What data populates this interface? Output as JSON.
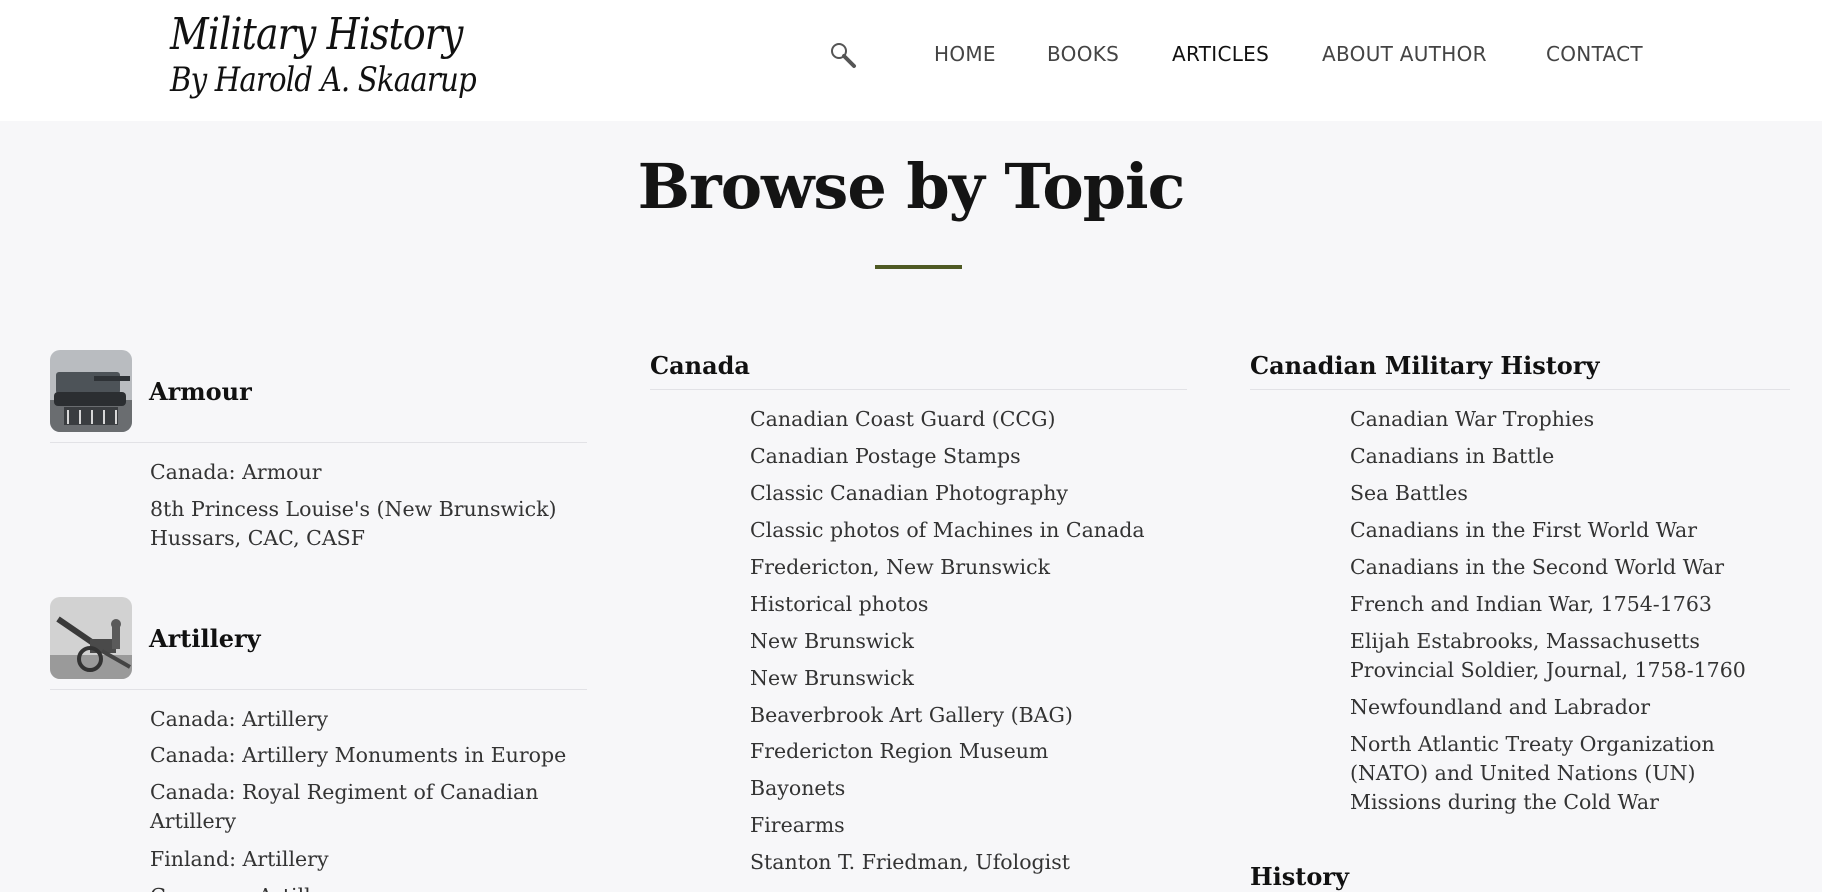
{
  "header": {
    "logo_line1": "Military History",
    "logo_line2": "By Harold A. Skaarup",
    "search_icon": "search-icon",
    "nav": {
      "home": "HOME",
      "books": "BOOKS",
      "articles": "ARTICLES",
      "about": "ABOUT AUTHOR",
      "contact": "CONTACT"
    }
  },
  "main": {
    "title": "Browse by Topic",
    "accent_color": "#4f5a24"
  },
  "columns": {
    "armour": {
      "title": "Armour",
      "links": [
        "Canada: Armour",
        "8th Princess Louise's (New Brunswick) Hussars, CAC, CASF"
      ]
    },
    "artillery": {
      "title": "Artillery",
      "links": [
        "Canada: Artillery",
        "Canada: Artillery Monuments in Europe",
        "Canada: Royal Regiment of Canadian Artillery",
        "Finland: Artillery",
        "Germany: Artillery"
      ]
    },
    "canada": {
      "title": "Canada",
      "links": [
        "Canadian Coast Guard (CCG)",
        "Canadian Postage Stamps",
        "Classic Canadian Photography",
        "Classic photos of Machines in Canada",
        "Fredericton, New Brunswick",
        "Historical photos",
        "New Brunswick",
        "New Brunswick",
        "Beaverbrook Art Gallery (BAG)",
        "Fredericton Region Museum",
        "Bayonets",
        "Firearms",
        "Stanton T. Friedman, Ufologist"
      ]
    },
    "cmh": {
      "title": "Canadian Military History",
      "links": [
        "Canadian War Trophies",
        "Canadians in Battle",
        "Sea Battles",
        "Canadians in the First World War",
        "Canadians in the Second World War",
        "French and Indian War, 1754-1763",
        "Elijah Estabrooks, Massachusetts Provincial Soldier, Journal, 1758-1760",
        "Newfoundland and Labrador",
        "North Atlantic Treaty Organization (NATO) and United Nations (UN) Missions during the Cold War"
      ]
    },
    "history": {
      "title": "History"
    }
  }
}
